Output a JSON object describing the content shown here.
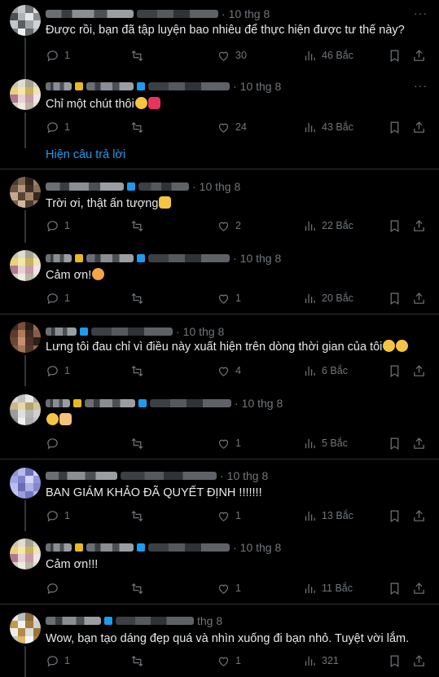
{
  "replies": [
    {
      "time": "10 thg 8",
      "text": "Được rồi, bạn đã tập luyện bao nhiêu để thực hiện được tư thế này?",
      "reply_count": "1",
      "retweet_count": "",
      "like_count": "30",
      "view_count": "46 Bắc",
      "emojis": []
    },
    {
      "time": "10 thg 8",
      "text": "Chỉ một chút thôi",
      "reply_count": "1",
      "retweet_count": "",
      "like_count": "24",
      "view_count": "43 Bắc",
      "emojis": [
        "kiss-face-emoji",
        "heart-emoji"
      ]
    },
    {
      "time": "10 thg 8",
      "text": "Trời ơi, thật ấn tượng",
      "reply_count": "1",
      "retweet_count": "",
      "like_count": "2",
      "view_count": "22 Bắc",
      "emojis": [
        "ok-hand-emoji"
      ]
    },
    {
      "time": "10 thg 8",
      "text": "Cảm ơn!",
      "reply_count": "1",
      "retweet_count": "",
      "like_count": "1",
      "view_count": "20 Bắc",
      "emojis": [
        "smile-hearts-emoji"
      ]
    },
    {
      "time": "10 thg 8",
      "text": "Lưng tôi đau chỉ vì điều này xuất hiện trên dòng thời gian của tôi",
      "reply_count": "1",
      "retweet_count": "",
      "like_count": "4",
      "view_count": "6 Bắc",
      "emojis": [
        "crying-emoji",
        "crying-emoji"
      ]
    },
    {
      "time": "10 thg 8",
      "text": "",
      "reply_count": "",
      "retweet_count": "",
      "like_count": "1",
      "view_count": "5 Bắc",
      "emojis": [
        "winking-emoji",
        "pray-emoji"
      ]
    },
    {
      "time": "10 thg 8",
      "text": "BAN GIÁM KHẢO ĐÃ QUYẾT ĐỊNH !!!!!!!",
      "reply_count": "1",
      "retweet_count": "",
      "like_count": "1",
      "view_count": "13 Bắc",
      "emojis": []
    },
    {
      "time": "10 thg 8",
      "text": "Cảm ơn!!!",
      "reply_count": "",
      "retweet_count": "",
      "like_count": "1",
      "view_count": "11 Bắc",
      "emojis": []
    },
    {
      "time": "thg 8",
      "text": "Wow, bạn tạo dáng đẹp quá và nhìn xuống đi bạn nhỏ. Tuyệt vời lắm.",
      "reply_count": "1",
      "retweet_count": "",
      "like_count": "1",
      "view_count": "321",
      "emojis": []
    }
  ],
  "show_replies_label": "Hiện câu trả lời",
  "more_label": "···",
  "icons": [
    "reply-icon",
    "retweet-icon",
    "like-icon",
    "views-icon",
    "bookmark-icon",
    "share-icon"
  ],
  "colors": {
    "background": "#000000",
    "text": "#e7e9ea",
    "muted": "#71767b",
    "accent": "#1d9bf0",
    "verified": "#1d9bf0",
    "divider": "#2f3336"
  }
}
